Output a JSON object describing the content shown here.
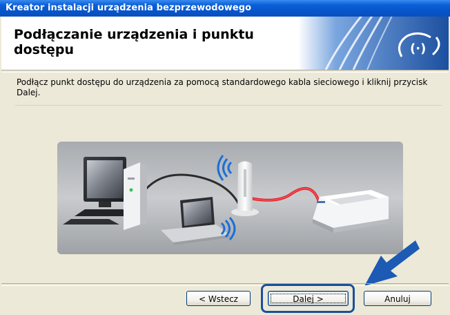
{
  "window": {
    "title": "Kreator instalacji urządzenia bezprzewodowego"
  },
  "header": {
    "title": "Podłączanie urządzenia i punktu dostępu"
  },
  "instruction": "Podłącz punkt dostępu do urządzenia za pomocą standardowego kabla sieciowego i kliknij przycisk Dalej.",
  "buttons": {
    "back": "< Wstecz",
    "next": "Dalej >",
    "cancel": "Anuluj"
  },
  "icons": {
    "banner": "wireless-signal-icon",
    "callout": "arrow-pointer-icon"
  },
  "colors": {
    "titlebar": "#0a5fd8",
    "dialog_bg": "#ECE9D8",
    "banner_blue": "#1c4f9f",
    "cable_red": "#e0202a",
    "highlight_blue": "#1a4f9e"
  }
}
